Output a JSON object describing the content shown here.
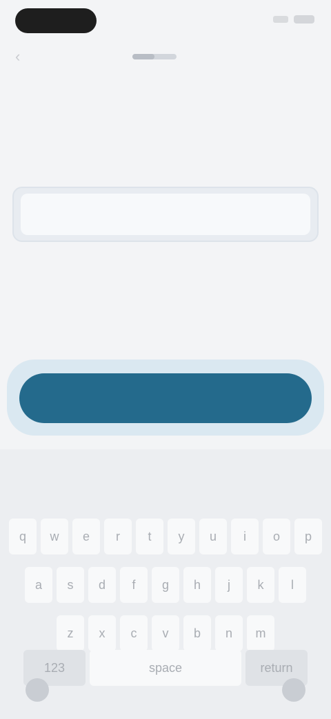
{
  "status": {
    "pill_color": "#1e1e1e"
  },
  "nav": {
    "back_icon": "chevron-left-icon",
    "progress_fraction": 0.5,
    "step_text": ""
  },
  "screen": {
    "title": "",
    "subtitle": ""
  },
  "email": {
    "value": "",
    "placeholder": ""
  },
  "cta": {
    "label": "",
    "color": "#246a8c"
  },
  "keyboard": {
    "suggestions": [
      "",
      "",
      ""
    ],
    "row1": [
      "q",
      "w",
      "e",
      "r",
      "t",
      "y",
      "u",
      "i",
      "o",
      "p"
    ],
    "row2": [
      "a",
      "s",
      "d",
      "f",
      "g",
      "h",
      "j",
      "k",
      "l"
    ],
    "row3": [
      "z",
      "x",
      "c",
      "v",
      "b",
      "n",
      "m"
    ],
    "num_label": "123",
    "space_label": "space",
    "return_label": "return",
    "globe_icon": "globe-icon",
    "mic_icon": "microphone-icon"
  }
}
